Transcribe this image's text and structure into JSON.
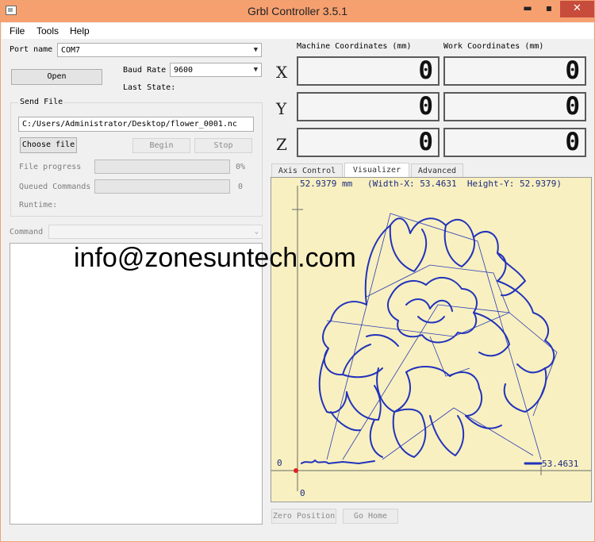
{
  "window": {
    "title": "Grbl Controller 3.5.1",
    "min_glyph": "▬",
    "max_glyph": "▪",
    "close_glyph": "✕"
  },
  "menu": {
    "items": [
      "File",
      "Tools",
      "Help"
    ]
  },
  "connection": {
    "port_label": "Port name",
    "port_value": "COM7",
    "open_button": "Open",
    "baud_label": "Baud Rate",
    "baud_value": "9600",
    "last_state_label": "Last State:"
  },
  "send_file": {
    "group_label": "Send File",
    "path": "C:/Users/Administrator/Desktop/flower_0001.nc",
    "choose_button": "Choose file",
    "begin_button": "Begin",
    "stop_button": "Stop",
    "file_progress_label": "File progress",
    "file_progress_value": "0%",
    "file_progress_fraction": 0,
    "queued_label": "Queued Commands",
    "queued_value": "0",
    "runtime_label": "Runtime:"
  },
  "command": {
    "label": "Command",
    "value": ""
  },
  "coordinates": {
    "machine_header": "Machine Coordinates (mm)",
    "work_header": "Work Coordinates (mm)",
    "axes": [
      {
        "axis": "X",
        "machine": "0",
        "work": "0"
      },
      {
        "axis": "Y",
        "machine": "0",
        "work": "0"
      },
      {
        "axis": "Z",
        "machine": "0",
        "work": "0"
      }
    ]
  },
  "tabs": [
    "Axis Control",
    "Visualizer",
    "Advanced"
  ],
  "active_tab": "Visualizer",
  "visualizer": {
    "top_value": "52.9379 mm",
    "dimensions": "(Width-X: 53.4631  Height-Y: 52.9379)",
    "origin_x_label": "0",
    "origin_y_label": "0",
    "right_value": "53.4631",
    "background_color": "#f8f0c0",
    "path_color": "#2233bb"
  },
  "bottom_buttons": {
    "zero_position": "Zero Position",
    "go_home": "Go Home"
  },
  "overlay": {
    "watermark": "info@zonesuntech.com"
  }
}
